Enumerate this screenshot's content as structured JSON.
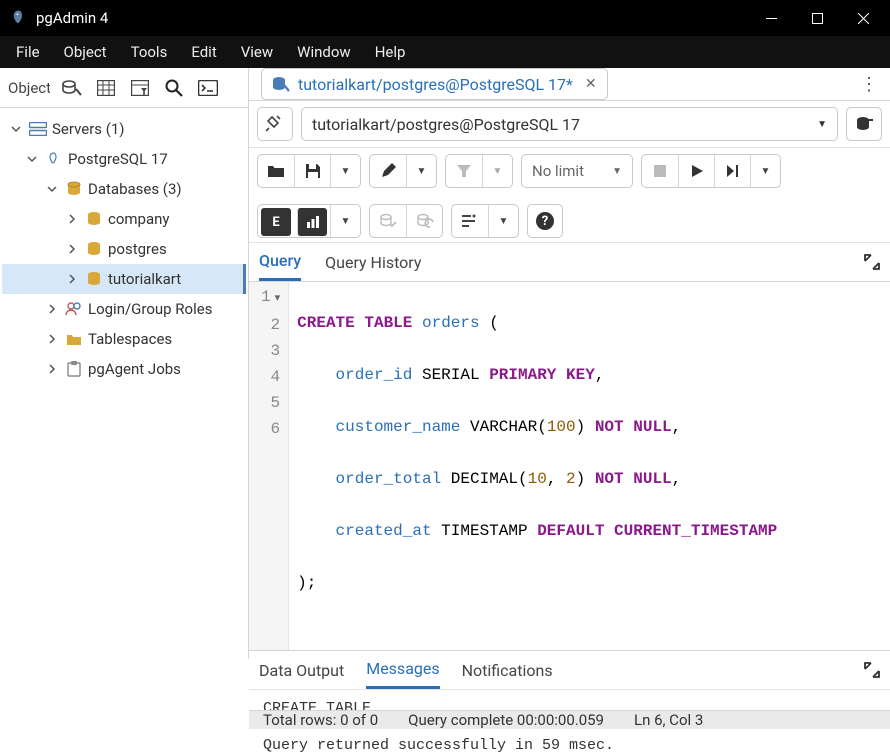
{
  "app": {
    "title": "pgAdmin 4"
  },
  "menubar": [
    "File",
    "Object",
    "Tools",
    "Edit",
    "View",
    "Window",
    "Help"
  ],
  "sidebar": {
    "label": "Object Explorer",
    "tree": {
      "servers": {
        "label": "Servers (1)"
      },
      "pg17": {
        "label": "PostgreSQL 17"
      },
      "databases": {
        "label": "Databases (3)"
      },
      "db_company": {
        "label": "company"
      },
      "db_postgres": {
        "label": "postgres"
      },
      "db_tutorialkart": {
        "label": "tutorialkart"
      },
      "login": {
        "label": "Login/Group Roles"
      },
      "tablespaces": {
        "label": "Tablespaces"
      },
      "pgagent": {
        "label": "pgAgent Jobs"
      }
    }
  },
  "tab": {
    "title": "tutorialkart/postgres@PostgreSQL 17*"
  },
  "connection": {
    "value": "tutorialkart/postgres@PostgreSQL 17"
  },
  "limit": {
    "label": "No limit"
  },
  "query_tabs": {
    "query": "Query",
    "history": "Query History"
  },
  "editor": {
    "lines": [
      {
        "n": 1,
        "fold": true
      },
      {
        "n": 2
      },
      {
        "n": 3
      },
      {
        "n": 4
      },
      {
        "n": 5
      },
      {
        "n": 6
      }
    ],
    "sql": {
      "l1a": "CREATE",
      "l1b": "TABLE",
      "l1c": "orders",
      "l1d": "(",
      "l2a": "order_id",
      "l2b": "SERIAL",
      "l2c": "PRIMARY",
      "l2d": "KEY",
      "l2e": ",",
      "l3a": "customer_name",
      "l3b": "VARCHAR",
      "l3c": "100",
      "l3d": "NOT",
      "l3e": "NULL",
      "l3f": ",",
      "l4a": "order_total",
      "l4b": "DECIMAL",
      "l4c": "10",
      "l4d": "2",
      "l4e": "NOT",
      "l4f": "NULL",
      "l4g": ",",
      "l5a": "created_at",
      "l5b": "TIMESTAMP",
      "l5c": "DEFAULT",
      "l5d": "CURRENT_TIMESTAMP",
      "l6": ");"
    }
  },
  "output_tabs": {
    "data": "Data Output",
    "messages": "Messages",
    "notifications": "Notifications"
  },
  "messages": {
    "l1": "CREATE TABLE",
    "l2": "Query returned successfully in 59 msec."
  },
  "status": {
    "rows": "Total rows: 0 of 0",
    "time": "Query complete 00:00:00.059",
    "pos": "Ln 6, Col 3"
  }
}
